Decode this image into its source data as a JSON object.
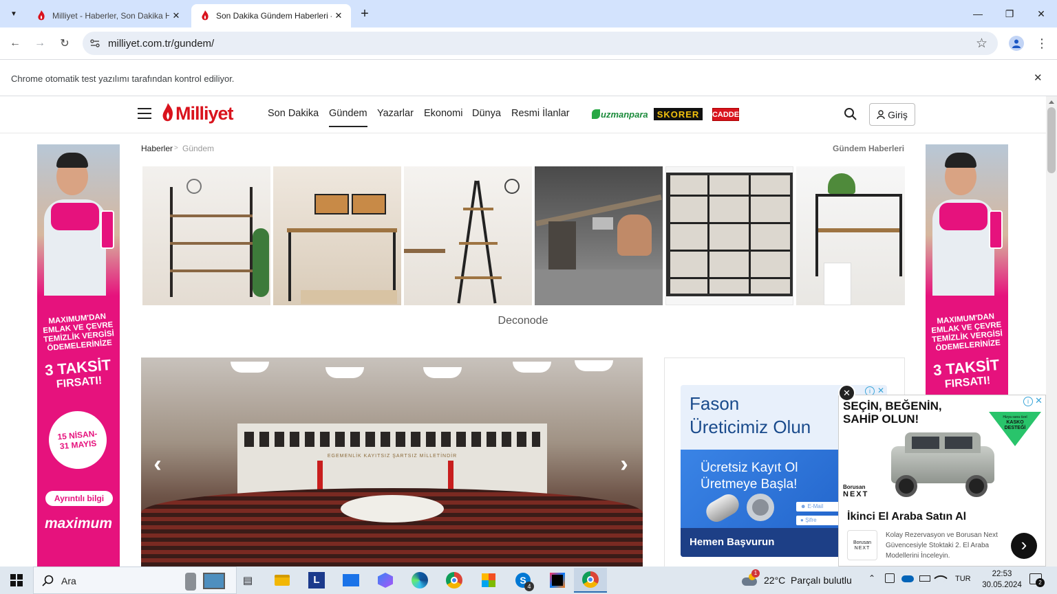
{
  "browser": {
    "tabs": [
      {
        "title": "Milliyet - Haberler, Son Dakika Haberle",
        "close": "✕"
      },
      {
        "title": "Son Dakika Gündem Haberleri - ",
        "close": "✕"
      }
    ],
    "new_tab": "+",
    "url": "milliyet.com.tr/gundem/",
    "infobar_text": "Chrome otomatik test yazılımı tarafından kontrol ediliyor.",
    "infobar_close": "✕"
  },
  "site": {
    "logo_text": "Milliyet",
    "nav": [
      {
        "label": "Son Dakika"
      },
      {
        "label": "Gündem"
      },
      {
        "label": "Yazarlar"
      },
      {
        "label": "Ekonomi"
      },
      {
        "label": "Dünya"
      },
      {
        "label": "Resmi İlanlar"
      }
    ],
    "partners": {
      "uzmanpara": "uzmanpara",
      "skorer": "SKORER",
      "cadde": "CADDE"
    },
    "login_label": "Giriş"
  },
  "breadcrumb": {
    "home": "Haberler",
    "separator": ">",
    "current": "Gündem",
    "section_title": "Gündem Haberleri"
  },
  "product_ad": {
    "brand": "Deconode"
  },
  "side_ad": {
    "headline": "MAXIMUM'DAN EMLAK VE ÇEVRE TEMİZLİK VERGİSİ ÖDEMELERİNİZE",
    "offer_line1": "3 TAKSİT",
    "offer_line2": "FIRSATI!",
    "date_line1": "15 NİSAN-",
    "date_line2": "31 MAYIS",
    "cta": "Ayrıntılı bilgi",
    "brand": "maximum"
  },
  "slider": {
    "banner_text": "EGEMENLİK KAYITSIZ ŞARTSIZ MİLLETİNDİR",
    "prev": "‹",
    "next": "›"
  },
  "fason_ad": {
    "title_line1": "Fason",
    "title_line2": "Üreticimiz Olun",
    "sub_line1": "Ücretsiz Kayıt Ol",
    "sub_line2": "Üretmeye Başla!",
    "field1": "E-Mail",
    "field2": "Şifre",
    "cta": "Hemen Başvurun"
  },
  "float_ad": {
    "close": "✕",
    "headline_line1": "SEÇİN, BEĞENİN,",
    "headline_line2": "SAHİP OLUN!",
    "badge_line1": "Hizya sana özel",
    "badge_line2": "KASKO",
    "badge_line3": "DESTEĞİ",
    "brand_line1": "Borusan",
    "brand_line2": "NEXT",
    "title": "İkinci El Araba Satın Al",
    "desc": "Kolay Rezervasyon ve Borusan Next Güvencesiyle Stoktaki 2. El Araba Modellerini İnceleyin.",
    "go": "›"
  },
  "taskbar": {
    "search_placeholder": "Ara",
    "weather": "22°C  Parçalı bulutlu",
    "lang": "TUR",
    "time": "22:53",
    "date": "30.05.2024",
    "notif_count": "2",
    "skype_badge": "4",
    "weather_badge": "1"
  },
  "colors": {
    "milliyet_red": "#d9131d",
    "pink": "#e6127d",
    "tab_bg": "#d3e3fd",
    "taskbar": "#dfe7ef"
  }
}
